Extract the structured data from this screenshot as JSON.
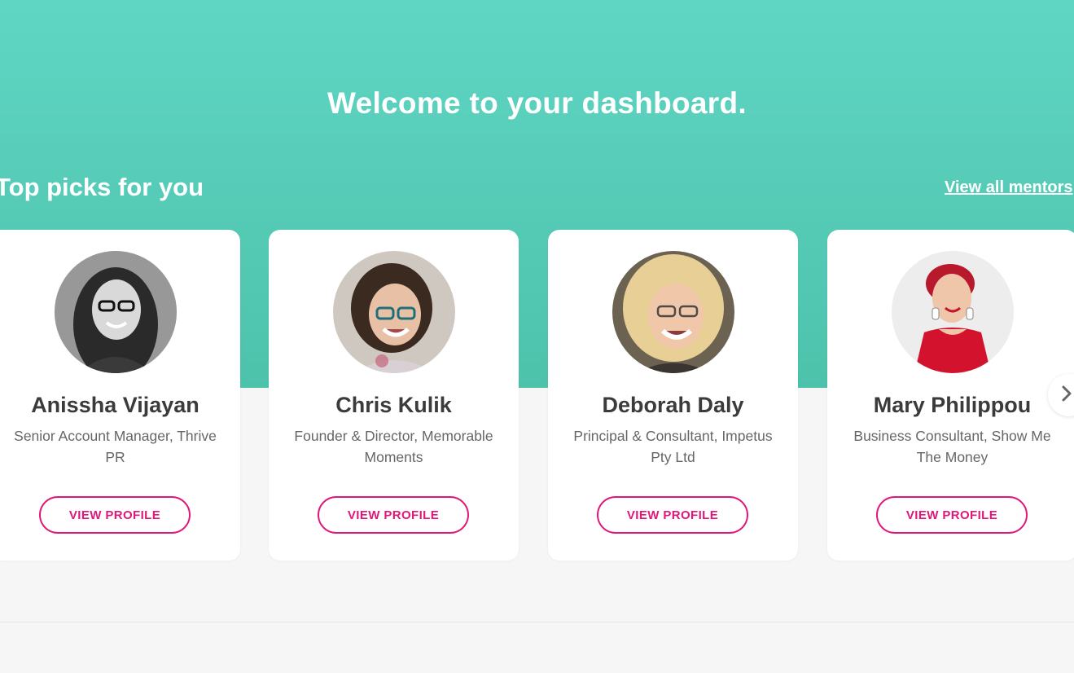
{
  "hero": {
    "welcome": "Welcome to your dashboard.",
    "section_title": "Top picks for you",
    "view_all": "View all mentors"
  },
  "mentors": [
    {
      "name": "Anissha Vijayan",
      "role": "Senior Account Manager, Thrive PR",
      "button": "VIEW PROFILE"
    },
    {
      "name": "Chris Kulik",
      "role": "Founder & Director, Memorable Moments",
      "button": "VIEW PROFILE"
    },
    {
      "name": "Deborah Daly",
      "role": "Principal & Consultant, Impetus Pty Ltd",
      "button": "VIEW PROFILE"
    },
    {
      "name": "Mary Philippou",
      "role": "Business Consultant, Show Me The Money",
      "button": "VIEW PROFILE"
    }
  ],
  "icons": {
    "next": "chevron-right-icon",
    "avatar": "person-avatar"
  },
  "colors": {
    "hero_top": "#5fd6c4",
    "hero_bottom": "#4dc2ab",
    "accent": "#e0187a",
    "background": "#f6f6f6"
  }
}
